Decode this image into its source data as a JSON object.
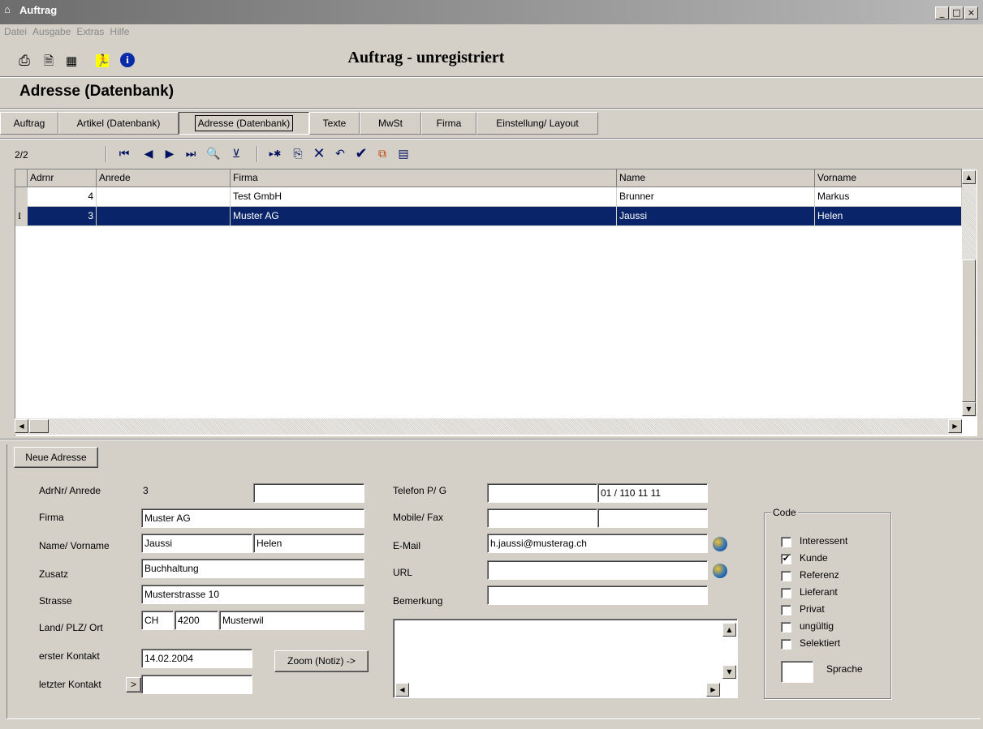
{
  "window": {
    "title": "Auftrag",
    "controls": [
      "_",
      "□",
      "×"
    ]
  },
  "menu": [
    "Datei",
    "Ausgabe",
    "Extras",
    "Hilfe"
  ],
  "toolbar": {
    "icons": [
      "printer-icon",
      "document-icon",
      "calculator-icon",
      "runner-icon",
      "info-icon"
    ],
    "app_title": "Auftrag - unregistriert"
  },
  "page_header": "Adresse (Datenbank)",
  "tabs": [
    "Auftrag",
    "Artikel (Datenbank)",
    "Adresse (Datenbank)",
    "Texte",
    "MwSt",
    "Firma",
    "Einstellung/ Layout"
  ],
  "active_tab": "Adresse (Datenbank)",
  "navigator": {
    "record_count": "2/2"
  },
  "grid": {
    "columns": [
      "Adrnr",
      "Anrede",
      "Firma",
      "Name",
      "Vorname"
    ],
    "rows": [
      {
        "adrnr": "4",
        "anrede": "",
        "firma": "Test GmbH",
        "name": "Brunner",
        "vorname": "Markus",
        "selected": false
      },
      {
        "adrnr": "3",
        "anrede": "",
        "firma": "Muster AG",
        "name": "Jaussi",
        "vorname": "Helen",
        "selected": true
      }
    ],
    "row_indicator": "I"
  },
  "form": {
    "new_button": "Neue Adresse",
    "labels": {
      "adrnr": "AdrNr/ Anrede",
      "firma": "Firma",
      "name": "Name/ Vorname",
      "zusatz": "Zusatz",
      "strasse": "Strasse",
      "land": "Land/ PLZ/ Ort",
      "erster": "erster Kontakt",
      "letzter": "letzter Kontakt",
      "telefon": "Telefon P/ G",
      "mobile": "Mobile/ Fax",
      "email": "E-Mail",
      "url": "URL",
      "bemerkung": "Bemerkung"
    },
    "values": {
      "adrnr": "3",
      "anrede": "",
      "firma": "Muster AG",
      "name": "Jaussi",
      "vorname": "Helen",
      "zusatz": "Buchhaltung",
      "strasse": "Musterstrasse 10",
      "land": "CH",
      "plz": "4200",
      "ort": "Musterwil",
      "erster": "14.02.2004",
      "letzter": "",
      "telefon_p": "",
      "telefon_g": "01 / 110 11 11",
      "mobile": "",
      "fax": "",
      "email": "h.jaussi@musterag.ch",
      "url": "",
      "bemerkung": "",
      "notiz": ""
    },
    "zoom_button": "Zoom (Notiz) ->",
    "letzter_button": ">",
    "code": {
      "title": "Code",
      "items": [
        {
          "label": "Interessent",
          "checked": false
        },
        {
          "label": "Kunde",
          "checked": true
        },
        {
          "label": "Referenz",
          "checked": false
        },
        {
          "label": "Lieferant",
          "checked": false
        },
        {
          "label": "Privat",
          "checked": false
        },
        {
          "label": "ungültig",
          "checked": false
        },
        {
          "label": "Selektiert",
          "checked": false
        }
      ],
      "sprache_label": "Sprache",
      "sprache_value": ""
    }
  }
}
